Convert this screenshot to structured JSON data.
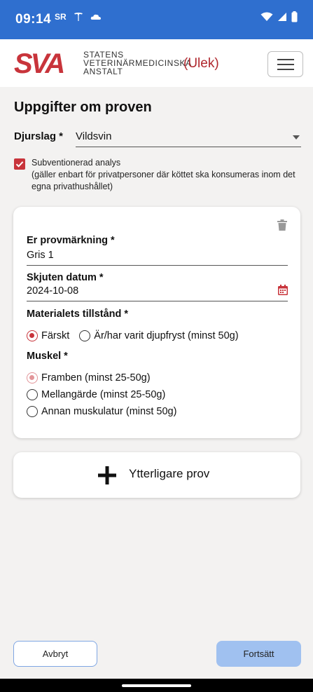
{
  "status_bar": {
    "time": "09:14",
    "icons": [
      "notification-sr-icon",
      "tesla-icon",
      "cloud-icon"
    ],
    "sr_text": "SR"
  },
  "header": {
    "logo_text": "SVA",
    "org_lines": [
      "STATENS",
      "VETERINÄRMEDICINSKA",
      "ANSTALT"
    ],
    "app_tag": "(Ulek)"
  },
  "page": {
    "title": "Uppgifter om proven"
  },
  "djurslag": {
    "label": "Djurslag *",
    "value": "Vildsvin"
  },
  "subvention": {
    "checked": true,
    "label": "Subventionerad analys",
    "note": "(gäller enbart för privatpersoner där köttet ska konsumeras inom det egna privathushållet)"
  },
  "sample": {
    "marking_label": "Er provmärkning *",
    "marking_value": "Gris 1",
    "date_label": "Skjuten datum *",
    "date_value": "2024-10-08",
    "material_label": "Materialets tillstånd *",
    "material_options": [
      "Färskt",
      "Är/har varit djupfryst (minst 50g)"
    ],
    "material_selected": 0,
    "muscle_label": "Muskel *",
    "muscle_options": [
      "Framben (minst 25-50g)",
      "Mellangärde (minst 25-50g)",
      "Annan muskulatur (minst 50g)"
    ],
    "muscle_selected": 0
  },
  "add_sample": {
    "label": "Ytterligare prov"
  },
  "footer": {
    "cancel_label": "Avbryt",
    "next_label": "Fortsätt"
  },
  "colors": {
    "status_bar": "#2f6fcf",
    "brand_red": "#c8343b",
    "primary_button": "#a0c1f0"
  }
}
